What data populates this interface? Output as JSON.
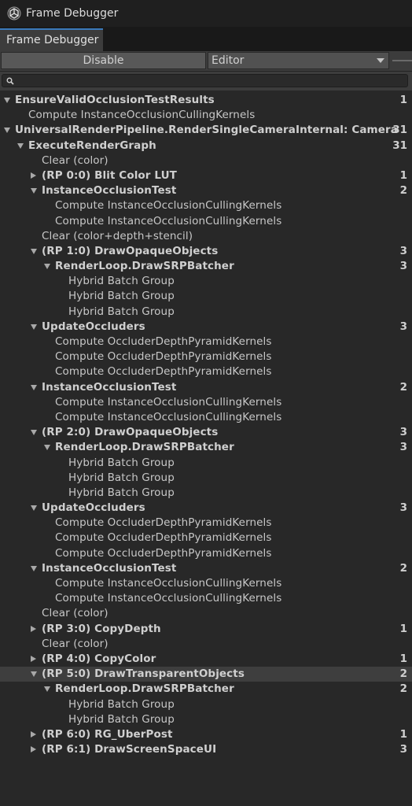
{
  "window": {
    "title": "Frame Debugger"
  },
  "tab": {
    "label": "Frame Debugger"
  },
  "toolbar": {
    "disable_label": "Disable",
    "target_value": "Editor"
  },
  "search": {
    "value": ""
  },
  "tree": [
    {
      "label": "EnsureValidOcclusionTestResults",
      "count": "1",
      "depth": 0,
      "bold": true,
      "arrow": "down"
    },
    {
      "label": "Compute InstanceOcclusionCullingKernels",
      "count": "",
      "depth": 1,
      "bold": false,
      "arrow": ""
    },
    {
      "label": "UniversalRenderPipeline.RenderSingleCameraInternal: Camera",
      "count": "31",
      "depth": 0,
      "bold": true,
      "arrow": "down"
    },
    {
      "label": "ExecuteRenderGraph",
      "count": "31",
      "depth": 1,
      "bold": true,
      "arrow": "down"
    },
    {
      "label": "Clear (color)",
      "count": "",
      "depth": 2,
      "bold": false,
      "arrow": ""
    },
    {
      "label": "(RP 0:0) Blit Color LUT",
      "count": "1",
      "depth": 2,
      "bold": true,
      "arrow": "right"
    },
    {
      "label": "InstanceOcclusionTest",
      "count": "2",
      "depth": 2,
      "bold": true,
      "arrow": "down"
    },
    {
      "label": "Compute InstanceOcclusionCullingKernels",
      "count": "",
      "depth": 3,
      "bold": false,
      "arrow": ""
    },
    {
      "label": "Compute InstanceOcclusionCullingKernels",
      "count": "",
      "depth": 3,
      "bold": false,
      "arrow": ""
    },
    {
      "label": "Clear (color+depth+stencil)",
      "count": "",
      "depth": 2,
      "bold": false,
      "arrow": ""
    },
    {
      "label": "(RP 1:0) DrawOpaqueObjects",
      "count": "3",
      "depth": 2,
      "bold": true,
      "arrow": "down"
    },
    {
      "label": "RenderLoop.DrawSRPBatcher",
      "count": "3",
      "depth": 3,
      "bold": true,
      "arrow": "down"
    },
    {
      "label": "Hybrid Batch Group",
      "count": "",
      "depth": 4,
      "bold": false,
      "arrow": ""
    },
    {
      "label": "Hybrid Batch Group",
      "count": "",
      "depth": 4,
      "bold": false,
      "arrow": ""
    },
    {
      "label": "Hybrid Batch Group",
      "count": "",
      "depth": 4,
      "bold": false,
      "arrow": ""
    },
    {
      "label": "UpdateOccluders",
      "count": "3",
      "depth": 2,
      "bold": true,
      "arrow": "down"
    },
    {
      "label": "Compute OccluderDepthPyramidKernels",
      "count": "",
      "depth": 3,
      "bold": false,
      "arrow": ""
    },
    {
      "label": "Compute OccluderDepthPyramidKernels",
      "count": "",
      "depth": 3,
      "bold": false,
      "arrow": ""
    },
    {
      "label": "Compute OccluderDepthPyramidKernels",
      "count": "",
      "depth": 3,
      "bold": false,
      "arrow": ""
    },
    {
      "label": "InstanceOcclusionTest",
      "count": "2",
      "depth": 2,
      "bold": true,
      "arrow": "down"
    },
    {
      "label": "Compute InstanceOcclusionCullingKernels",
      "count": "",
      "depth": 3,
      "bold": false,
      "arrow": ""
    },
    {
      "label": "Compute InstanceOcclusionCullingKernels",
      "count": "",
      "depth": 3,
      "bold": false,
      "arrow": ""
    },
    {
      "label": "(RP 2:0) DrawOpaqueObjects",
      "count": "3",
      "depth": 2,
      "bold": true,
      "arrow": "down"
    },
    {
      "label": "RenderLoop.DrawSRPBatcher",
      "count": "3",
      "depth": 3,
      "bold": true,
      "arrow": "down"
    },
    {
      "label": "Hybrid Batch Group",
      "count": "",
      "depth": 4,
      "bold": false,
      "arrow": ""
    },
    {
      "label": "Hybrid Batch Group",
      "count": "",
      "depth": 4,
      "bold": false,
      "arrow": ""
    },
    {
      "label": "Hybrid Batch Group",
      "count": "",
      "depth": 4,
      "bold": false,
      "arrow": ""
    },
    {
      "label": "UpdateOccluders",
      "count": "3",
      "depth": 2,
      "bold": true,
      "arrow": "down"
    },
    {
      "label": "Compute OccluderDepthPyramidKernels",
      "count": "",
      "depth": 3,
      "bold": false,
      "arrow": ""
    },
    {
      "label": "Compute OccluderDepthPyramidKernels",
      "count": "",
      "depth": 3,
      "bold": false,
      "arrow": ""
    },
    {
      "label": "Compute OccluderDepthPyramidKernels",
      "count": "",
      "depth": 3,
      "bold": false,
      "arrow": ""
    },
    {
      "label": "InstanceOcclusionTest",
      "count": "2",
      "depth": 2,
      "bold": true,
      "arrow": "down"
    },
    {
      "label": "Compute InstanceOcclusionCullingKernels",
      "count": "",
      "depth": 3,
      "bold": false,
      "arrow": ""
    },
    {
      "label": "Compute InstanceOcclusionCullingKernels",
      "count": "",
      "depth": 3,
      "bold": false,
      "arrow": ""
    },
    {
      "label": "Clear (color)",
      "count": "",
      "depth": 2,
      "bold": false,
      "arrow": ""
    },
    {
      "label": "(RP 3:0) CopyDepth",
      "count": "1",
      "depth": 2,
      "bold": true,
      "arrow": "right"
    },
    {
      "label": "Clear (color)",
      "count": "",
      "depth": 2,
      "bold": false,
      "arrow": ""
    },
    {
      "label": "(RP 4:0) CopyColor",
      "count": "1",
      "depth": 2,
      "bold": true,
      "arrow": "right"
    },
    {
      "label": "(RP 5:0) DrawTransparentObjects",
      "count": "2",
      "depth": 2,
      "bold": true,
      "arrow": "down",
      "selected": true
    },
    {
      "label": "RenderLoop.DrawSRPBatcher",
      "count": "2",
      "depth": 3,
      "bold": true,
      "arrow": "down"
    },
    {
      "label": "Hybrid Batch Group",
      "count": "",
      "depth": 4,
      "bold": false,
      "arrow": ""
    },
    {
      "label": "Hybrid Batch Group",
      "count": "",
      "depth": 4,
      "bold": false,
      "arrow": ""
    },
    {
      "label": "(RP 6:0) RG_UberPost",
      "count": "1",
      "depth": 2,
      "bold": true,
      "arrow": "right"
    },
    {
      "label": "(RP 6:1) DrawScreenSpaceUI",
      "count": "3",
      "depth": 2,
      "bold": true,
      "arrow": "right"
    }
  ]
}
